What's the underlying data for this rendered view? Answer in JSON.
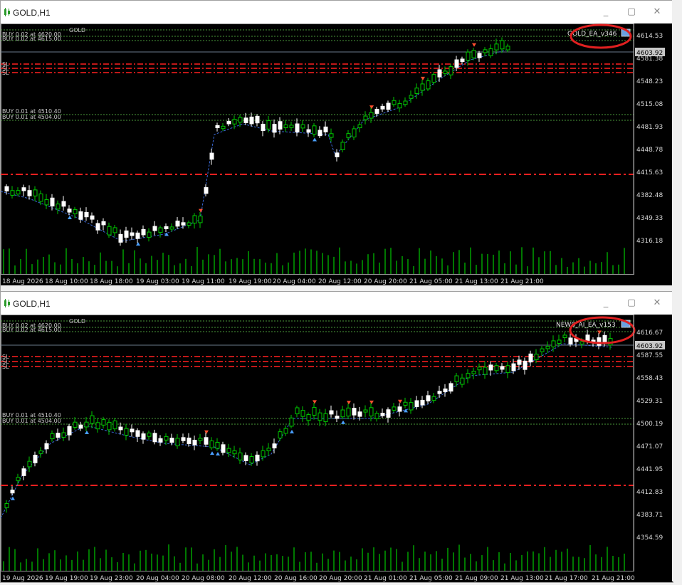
{
  "windows": [
    {
      "title": "GOLD,H1",
      "ea_label": "GOLD_EA_v346",
      "info_lines": [
        "GOLD",
        "BUY 0.02 at 4620.00",
        "BUY 0.02 at 4615.00"
      ],
      "sl_labels": [
        "SL",
        "SL",
        "SL"
      ],
      "left_orders": [
        "BUY 0.01 at 4510.40",
        "BUY 0.01 at 4504.00"
      ],
      "price_labels": [
        "4614.53",
        "4581.38",
        "4548.23",
        "4515.08",
        "4481.93",
        "4448.78",
        "4415.63",
        "4382.48",
        "4349.33",
        "4316.18"
      ],
      "current_price": "4603.92",
      "time_labels": [
        "18 Aug 2026",
        "18 Aug 10:00",
        "18 Aug 18:00",
        "19 Aug 03:00",
        "19 Aug 11:00",
        "19 Aug 19:00",
        "20 Aug 04:00",
        "20 Aug 12:00",
        "20 Aug 20:00",
        "21 Aug 05:00",
        "21 Aug 13:00",
        "21 Aug 21:00"
      ]
    },
    {
      "title": "GOLD,H1",
      "ea_label": "NEWS_AI_EA_v153",
      "info_lines": [
        "GOLD",
        "BUY 0.02 at 4620.00",
        "BUY 0.02 at 4615.00"
      ],
      "sl_labels": [
        "SL",
        "SL",
        "SL"
      ],
      "left_orders": [
        "BUY 0.01 at 4510.40",
        "BUY 0.01 at 4504.00"
      ],
      "price_labels": [
        "4616.67",
        "4587.55",
        "4558.43",
        "4529.31",
        "4500.19",
        "4471.07",
        "4441.95",
        "4412.83",
        "4383.71",
        "4354.59"
      ],
      "current_price": "4603.92",
      "time_labels": [
        "19 Aug 2026",
        "19 Aug 19:00",
        "19 Aug 23:00",
        "20 Aug 04:00",
        "20 Aug 08:00",
        "20 Aug 12:00",
        "20 Aug 16:00",
        "20 Aug 20:00",
        "21 Aug 01:00",
        "21 Aug 05:00",
        "21 Aug 09:00",
        "21 Aug 13:00",
        "21 Aug 17:00",
        "21 Aug 21:00"
      ]
    }
  ],
  "colors": {
    "background": "#000000",
    "bull_candle": "#00c800",
    "bear_candle": "#ffffff",
    "sl_line": "#ff2020",
    "order_line": "#4a9a3a",
    "trend_line": "#3a6ad8",
    "highlight_circle": "#e02020"
  }
}
